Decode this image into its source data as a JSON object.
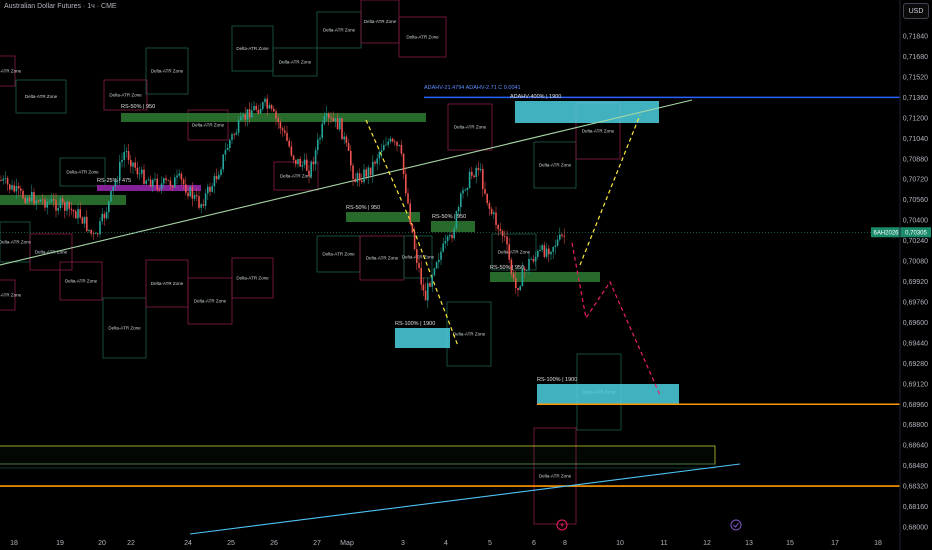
{
  "header": {
    "symbol_title": "Australian Dollar Futures · 1ч · CME",
    "currency_button": "USD"
  },
  "colors": {
    "background": "#000000",
    "candle_up": "#26a69a",
    "candle_down": "#ef5350",
    "zone_green": "#2e7d32",
    "zone_cyan": "#4dd0e1",
    "zone_purple": "#9c27b0",
    "line_blue": "#2962ff",
    "line_orange": "#ff9800",
    "line_trend": "#a5d6a7",
    "line_cyan": "#4fc3f7",
    "projection_yellow": "#ffeb3b",
    "projection_red": "#e91e63",
    "price_tag": "#1b8a6b"
  },
  "chart_data": {
    "type": "candlestick",
    "y_axis_ticks": [
      "0,71840",
      "0,71680",
      "0,71520",
      "0,71360",
      "0,71200",
      "0,71040",
      "0,70880",
      "0,70720",
      "0,70560",
      "0,70400",
      "0,70240",
      "0,70080",
      "0,69920",
      "0,69760",
      "0,69600",
      "0,69440",
      "0,69280",
      "0,69120",
      "0,68960",
      "0,68800",
      "0,68640",
      "0,68480",
      "0,68320",
      "0,68160",
      "0,68000"
    ],
    "ylim": [
      0.68,
      0.7184
    ],
    "x_axis_ticks": [
      "18",
      "19",
      "20",
      "22",
      "24",
      "25",
      "26",
      "27",
      "Мар",
      "3",
      "4",
      "5",
      "6",
      "8",
      "10",
      "11",
      "12",
      "13",
      "15",
      "17",
      "18"
    ],
    "current_price": "0,70305",
    "current_symbol": "6AH2026",
    "current_value": 0.70305,
    "zones_label": "Delta-ATR Zone",
    "annotations": [
      "RS-50% | 950",
      "RS-25% | 475",
      "RS-50% | 950",
      "RS-50% | 950",
      "RS-100% | 1900",
      "RS-50% | 950",
      "RS-100% | 1900",
      "ADAHV-400% | 1900",
      "ADAHV-21.4794 ADAHV-2.71 C 0.0041"
    ],
    "levels": [
      0.7136,
      0.6896,
      0.6832
    ],
    "candles": []
  }
}
